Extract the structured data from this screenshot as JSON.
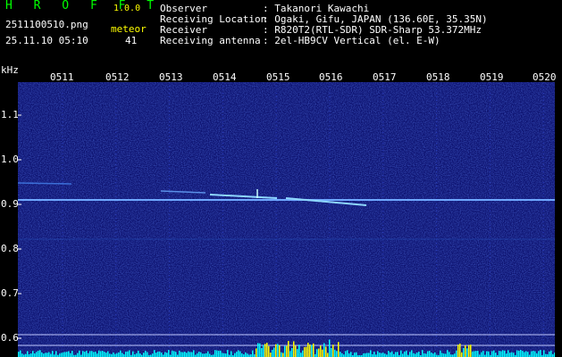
{
  "header": {
    "brand": "H R O F F T",
    "version": "1.0.0",
    "file_name": "2511100510.png",
    "meteor_label": "meteor",
    "datetime": "25.11.10 05:10",
    "meteor_count": "41"
  },
  "info": [
    {
      "label": "Observer",
      "value": ": Takanori Kawachi"
    },
    {
      "label": "Receiving Location",
      "value": ": Ogaki, Gifu, JAPAN (136.60E, 35.35N)"
    },
    {
      "label": "Receiver",
      "value": ": R820T2(RTL-SDR) SDR-Sharp 53.372MHz"
    },
    {
      "label": "Receiving antenna",
      "value": ": 2el-HB9CV Vertical (el. E-W)"
    }
  ],
  "axis": {
    "unit": "kHz",
    "y_ticks": [
      "1.1",
      "1.0",
      "0.9",
      "0.8",
      "0.7",
      "0.6"
    ],
    "time_ticks": [
      "0511",
      "0512",
      "0513",
      "0514",
      "0515",
      "0516",
      "0517",
      "0518",
      "0519",
      "0520"
    ]
  },
  "colors": {
    "background": "#000000",
    "plot_bg": "#0d1270",
    "carrier": "#6fa8ff",
    "echo": "#8fd8ff",
    "bar": "#00ffff",
    "bar_hot": "#ffff00"
  }
}
